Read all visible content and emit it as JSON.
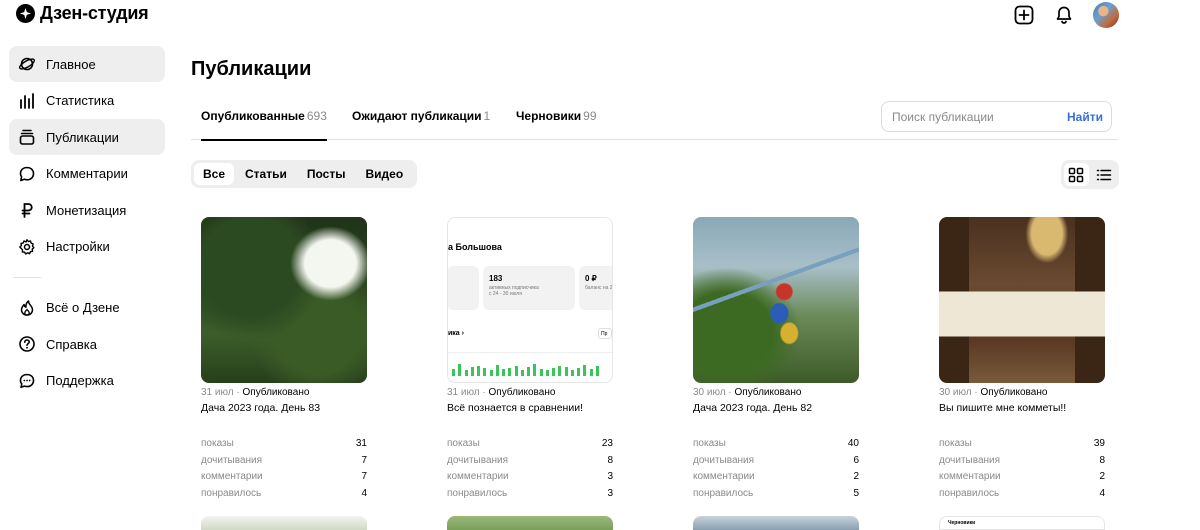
{
  "app": {
    "title": "Дзен-студия"
  },
  "sidebar": {
    "items": [
      {
        "label": "Главное",
        "icon": "planet-icon",
        "active": true
      },
      {
        "label": "Статистика",
        "icon": "bar-chart-icon",
        "active": false
      },
      {
        "label": "Публикации",
        "icon": "stack-icon",
        "active": true
      },
      {
        "label": "Комментарии",
        "icon": "speech-bubble-icon",
        "active": false
      },
      {
        "label": "Монетизация",
        "icon": "ruble-icon",
        "active": false
      },
      {
        "label": "Настройки",
        "icon": "gear-icon",
        "active": false
      }
    ],
    "extra": [
      {
        "label": "Всё о Дзене",
        "icon": "flame-icon"
      },
      {
        "label": "Справка",
        "icon": "question-icon"
      },
      {
        "label": "Поддержка",
        "icon": "support-chat-icon"
      }
    ]
  },
  "main": {
    "title": "Публикации",
    "tabs": [
      {
        "label": "Опубликованные",
        "count": "693",
        "active": true
      },
      {
        "label": "Ожидают публикации",
        "count": "1",
        "active": false
      },
      {
        "label": "Черновики",
        "count": "99",
        "active": false
      }
    ],
    "search": {
      "placeholder": "Поиск публикации",
      "button": "Найти"
    },
    "filters": [
      {
        "label": "Все",
        "active": true
      },
      {
        "label": "Статьи",
        "active": false
      },
      {
        "label": "Посты",
        "active": false
      },
      {
        "label": "Видео",
        "active": false
      }
    ],
    "stat_labels": {
      "views": "показы",
      "reads": "дочитывания",
      "comments": "комментарии",
      "likes": "понравилось"
    },
    "cards": [
      {
        "date": "31 июл",
        "status": "Опубликовано",
        "title": "Дача 2023 года. День 83",
        "thumb": "forest",
        "views": "31",
        "reads": "7",
        "comments": "7",
        "likes": "4"
      },
      {
        "date": "31 июл",
        "status": "Опубликовано",
        "title": "Всё познается в сравнении!",
        "thumb": "screen",
        "views": "23",
        "reads": "8",
        "comments": "3",
        "likes": "3"
      },
      {
        "date": "30 июл",
        "status": "Опубликовано",
        "title": "Дача 2023 года. День 82",
        "thumb": "green",
        "views": "40",
        "reads": "6",
        "comments": "2",
        "likes": "5"
      },
      {
        "date": "30 июл",
        "status": "Опубликовано",
        "title": "Вы пишите мне комметы!!",
        "thumb": "bedroom",
        "views": "39",
        "reads": "8",
        "comments": "2",
        "likes": "4"
      }
    ],
    "screen_thumb": {
      "name": "а Большова",
      "box1_num": "183",
      "box1_cap1": "активных подписчика",
      "box1_cap2": "с 24 - 30 июля",
      "box2_num": "0 ₽",
      "box2_cap": "баланс на 2",
      "sub": "ика ›",
      "pill": "Пр",
      "bars": [
        0.35,
        0.6,
        0.3,
        0.45,
        0.5,
        0.4,
        0.3,
        0.55,
        0.35,
        0.4,
        0.5,
        0.3,
        0.45,
        0.6,
        0.35,
        0.3,
        0.4,
        0.5,
        0.45,
        0.3,
        0.4,
        0.55,
        0.35,
        0.5
      ]
    },
    "next_row_thumbs": [
      "b1",
      "b2",
      "b3",
      "b4"
    ],
    "next_row_caption": "Черновики"
  },
  "colors": {
    "accent": "#3a6fd8",
    "active_bg": "#eeeeef",
    "muted": "#8a8a8a",
    "bar_green": "#3ac45a"
  }
}
